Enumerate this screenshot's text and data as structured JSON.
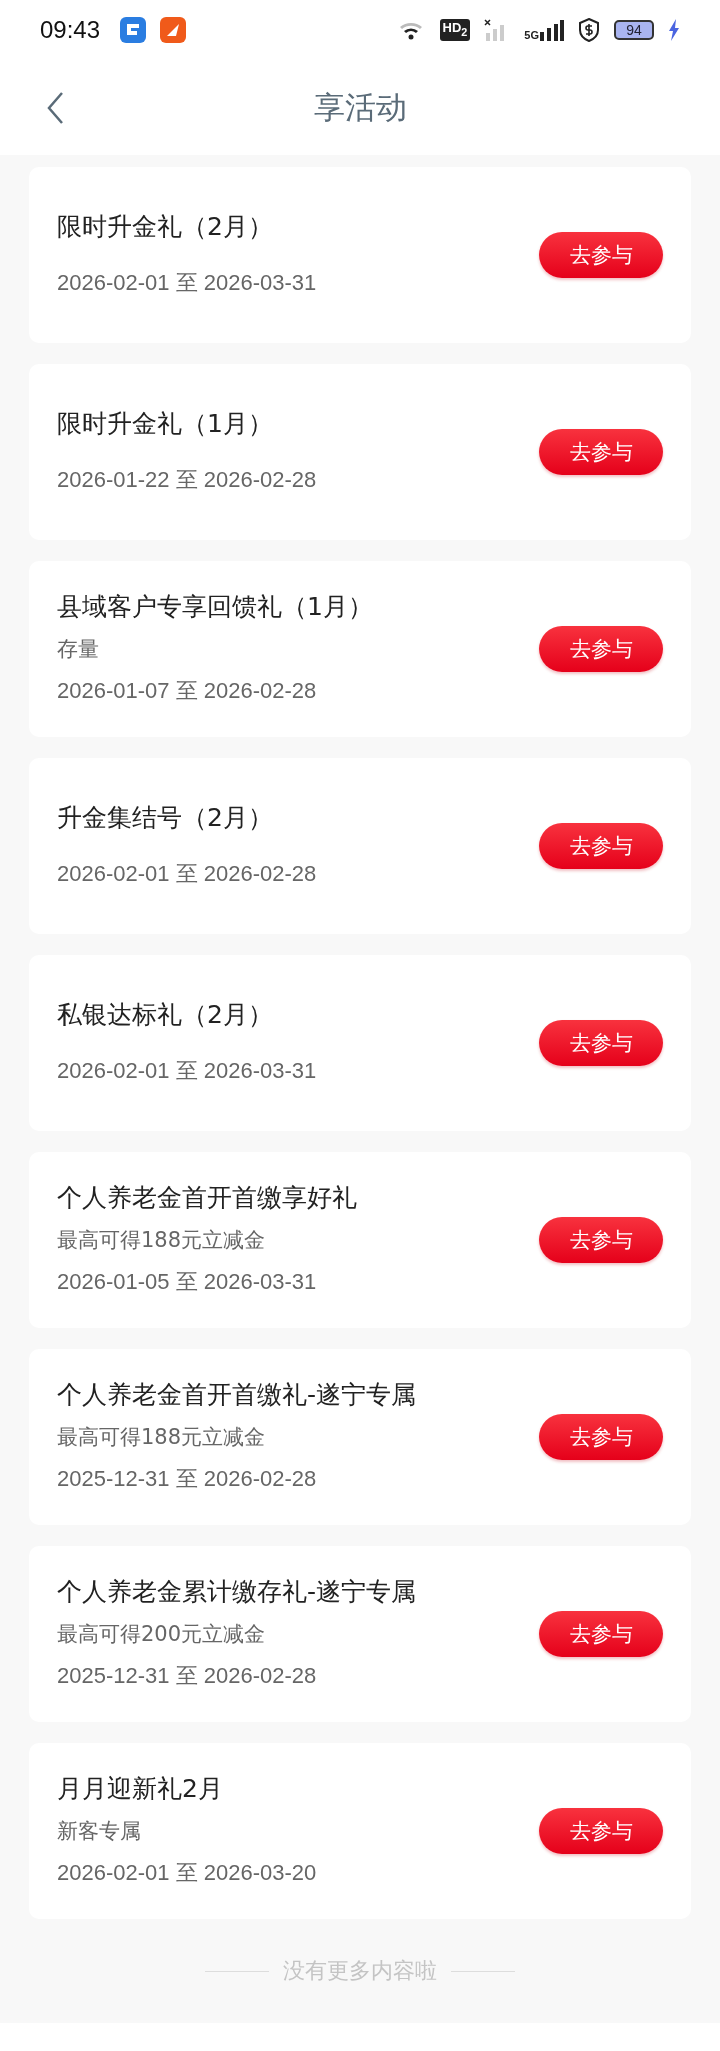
{
  "status_bar": {
    "time": "09:43",
    "hd_label": "HD$_{2}$",
    "network_label": "5G",
    "battery": "94"
  },
  "header": {
    "title": "享活动"
  },
  "activities": [
    {
      "title": "限时升金礼（2月）",
      "dates": "2026-02-01 至 2026-03-31",
      "button": "去参与"
    },
    {
      "title": "限时升金礼（1月）",
      "dates": "2026-01-22 至 2026-02-28",
      "button": "去参与"
    },
    {
      "title": "县域客户专享回馈礼（1月）",
      "subtitle": "存量",
      "dates": "2026-01-07 至 2026-02-28",
      "button": "去参与"
    },
    {
      "title": "升金集结号（2月）",
      "dates": "2026-02-01 至 2026-02-28",
      "button": "去参与"
    },
    {
      "title": "私银达标礼（2月）",
      "dates": "2026-02-01 至 2026-03-31",
      "button": "去参与"
    },
    {
      "title": "个人养老金首开首缴享好礼",
      "subtitle": "最高可得188元立减金",
      "dates": "2026-01-05 至 2026-03-31",
      "button": "去参与"
    },
    {
      "title": "个人养老金首开首缴礼-遂宁专属",
      "subtitle": "最高可得188元立减金",
      "dates": "2025-12-31 至 2026-02-28",
      "button": "去参与"
    },
    {
      "title": "个人养老金累计缴存礼-遂宁专属",
      "subtitle": "最高可得200元立减金",
      "dates": "2025-12-31 至 2026-02-28",
      "button": "去参与"
    },
    {
      "title": "月月迎新礼2月",
      "subtitle": "新客专属",
      "dates": "2026-02-01 至 2026-03-20",
      "button": "去参与"
    }
  ],
  "footer": {
    "text": "没有更多内容啦"
  }
}
